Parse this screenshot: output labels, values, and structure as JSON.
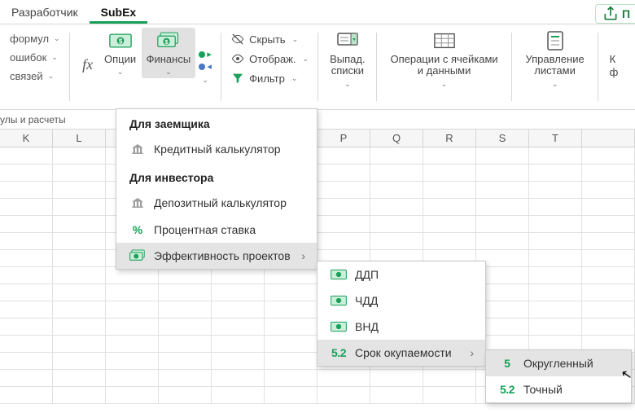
{
  "tabs": {
    "developer": "Разработчик",
    "subex": "SubEx",
    "share": "П"
  },
  "ribbon": {
    "left_small": [
      "формул",
      "ошибок",
      "связей"
    ],
    "fx_label": "fx",
    "options_label": "Опции",
    "finance_label": "Финансы",
    "filter_group": {
      "hide": "Скрыть",
      "show": "Отображ.",
      "filter": "Фильтр"
    },
    "dropdowns_label": "Выпад. списки",
    "cellops_label": "Операции с ячейками и данными",
    "sheets_label": "Управление листами",
    "last_partial": "ф"
  },
  "stub": "улы и расчеты",
  "columns": [
    "K",
    "L",
    "",
    "",
    "",
    "",
    "P",
    "Q",
    "R",
    "S",
    "T",
    ""
  ],
  "menu1": {
    "hdr_borrower": "Для заемщика",
    "credit_calc": "Кредитный калькулятор",
    "hdr_investor": "Для инвестора",
    "deposit_calc": "Депозитный калькулятор",
    "rate": "Процентная ставка",
    "efficiency": "Эффективность проектов"
  },
  "menu2": {
    "ddp": "ДДП",
    "chdd": "ЧДД",
    "vnd": "ВНД",
    "payback": "Срок окупаемости"
  },
  "menu3": {
    "rounded": "Округленный",
    "exact": "Точный"
  }
}
